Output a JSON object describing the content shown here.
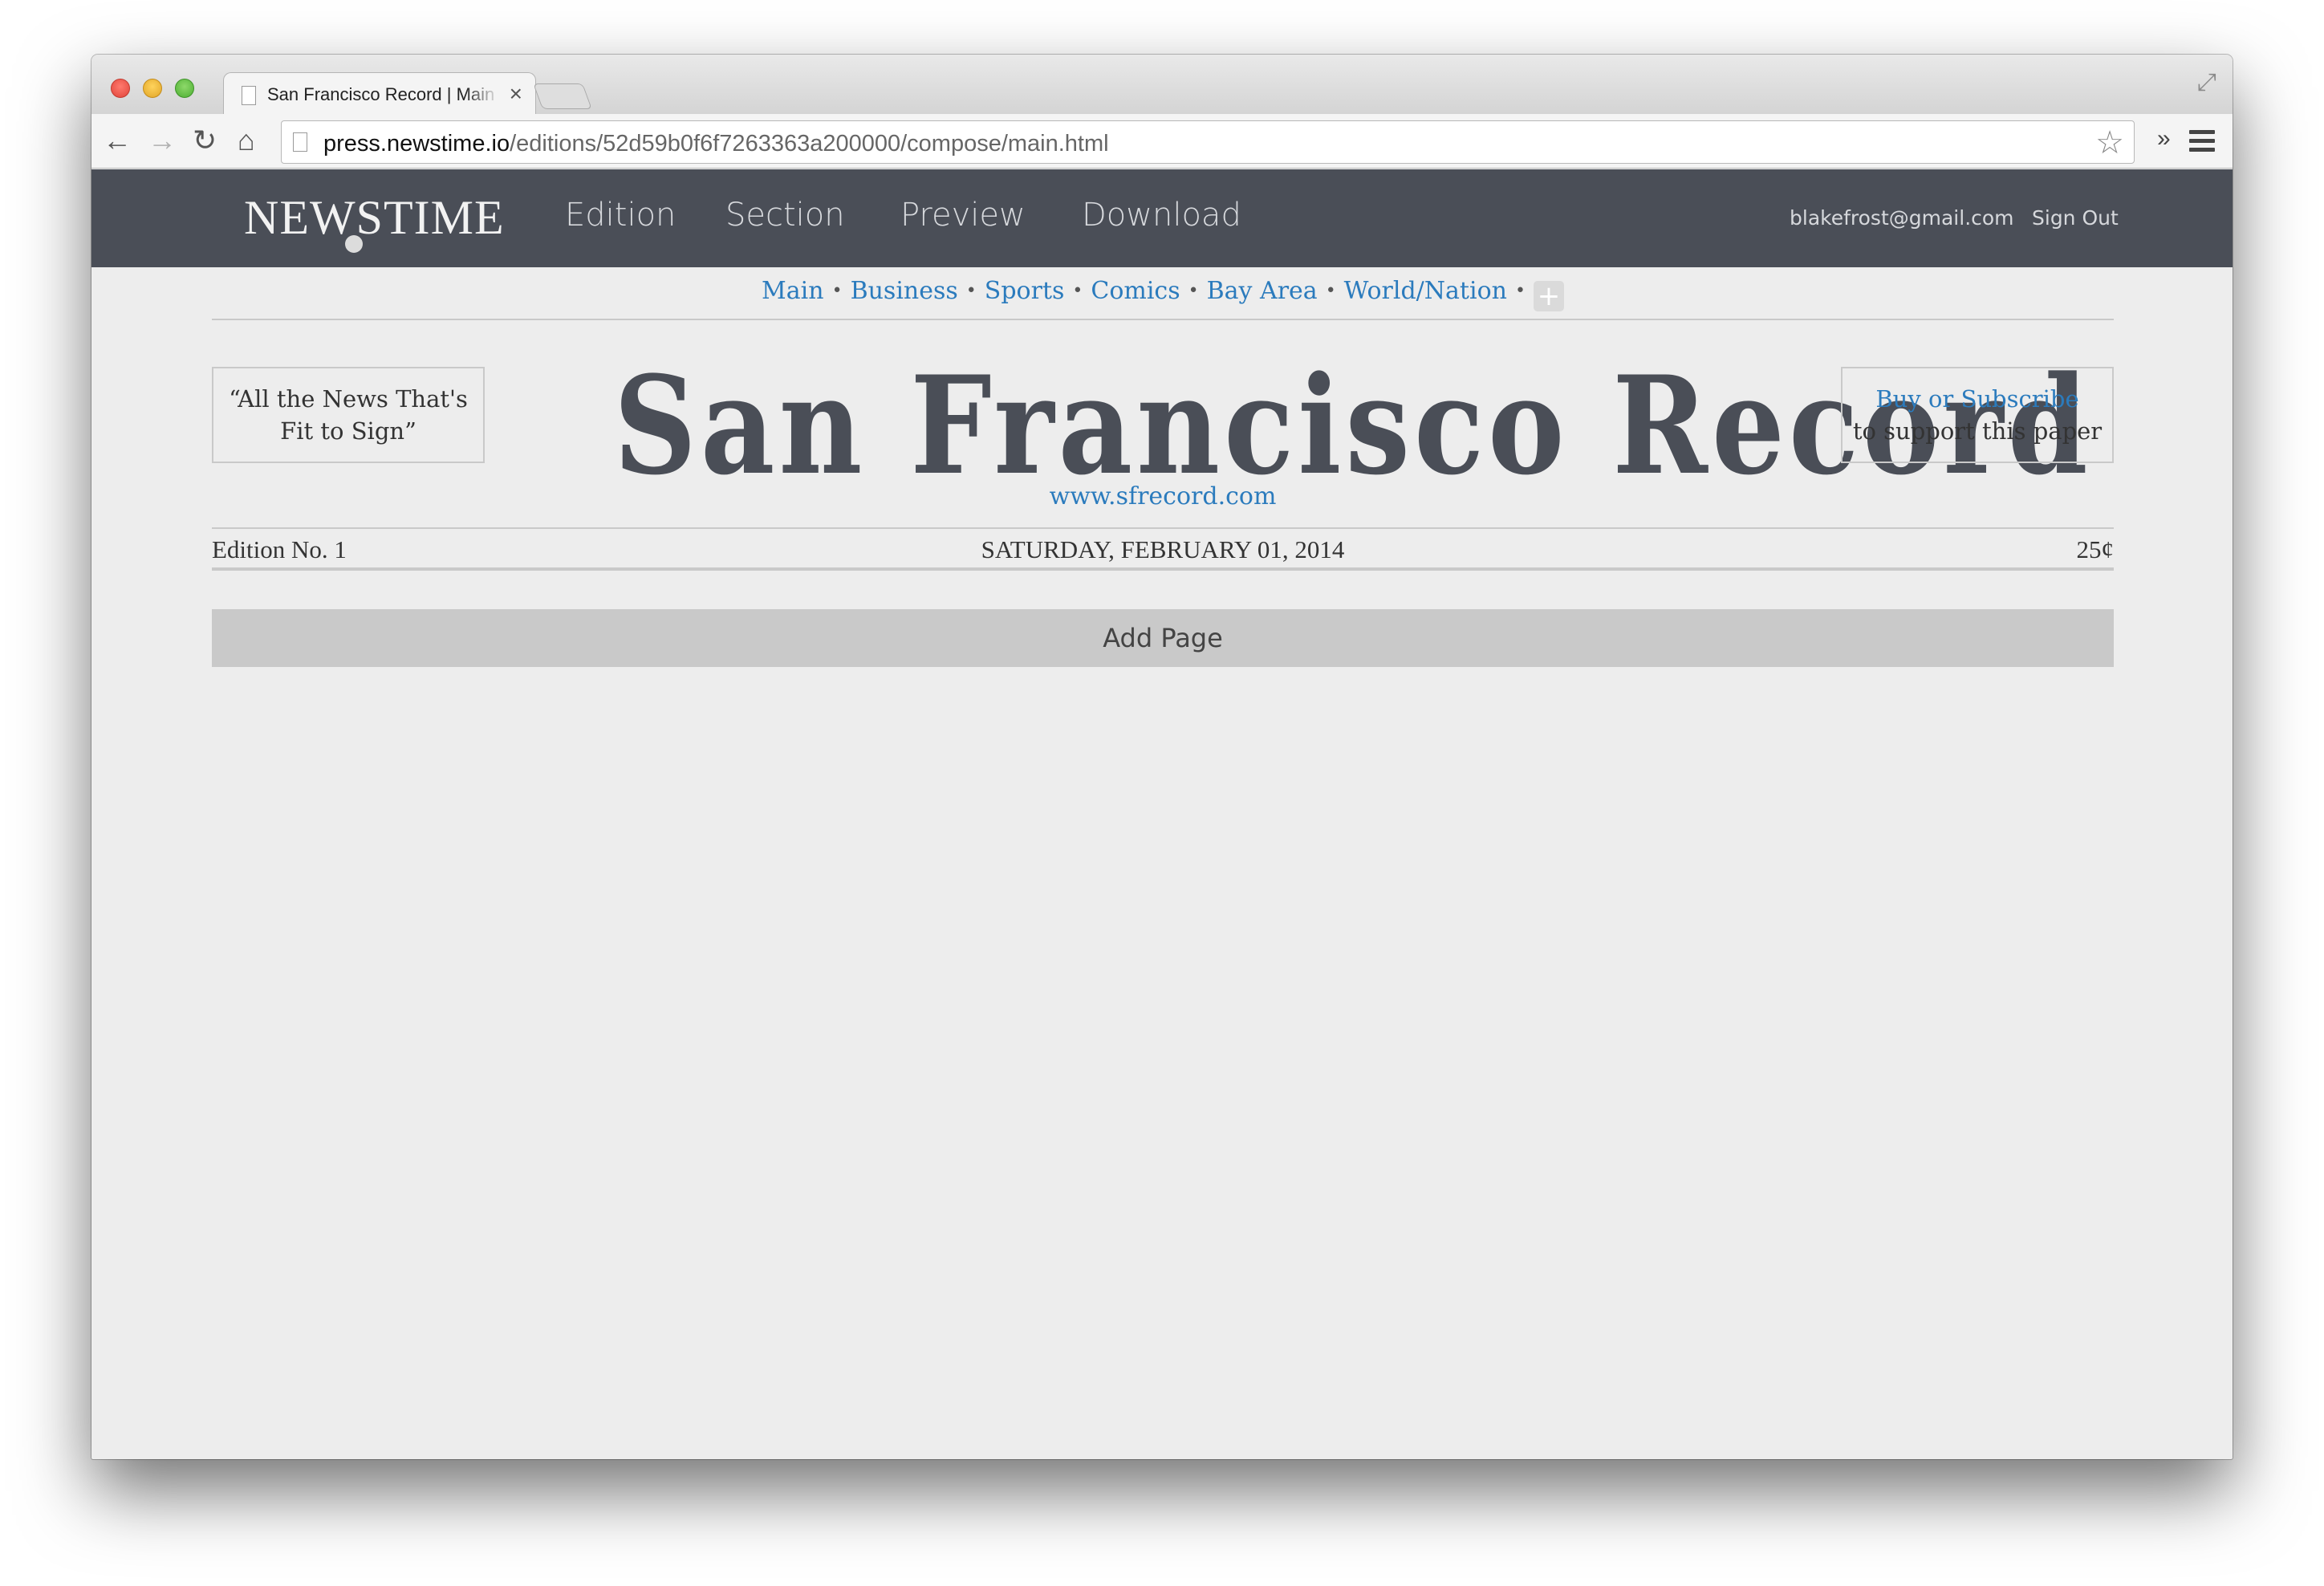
{
  "browser": {
    "tab_title": "San Francisco Record | Main",
    "url_host": "press.newstime.io",
    "url_path": "/editions/52d59b0f6f7263363a200000/compose/main.html"
  },
  "app": {
    "logo": "NEWSTIME",
    "nav": [
      "Edition",
      "Section",
      "Preview",
      "Download"
    ],
    "user_email": "blakefrost@gmail.com",
    "sign_out": "Sign Out"
  },
  "sections": [
    "Main",
    "Business",
    "Sports",
    "Comics",
    "Bay Area",
    "World/Nation"
  ],
  "masthead": {
    "left_ear": "“All the News That's Fit to Sign”",
    "title": "San Francisco Record",
    "url": "www.sfrecord.com",
    "right_ear_link": "Buy or Subscribe",
    "right_ear_text": "to support this paper"
  },
  "dateline": {
    "edition": "Edition No. 1",
    "date": "SATURDAY, FEBRUARY 01, 2014",
    "price": "25¢"
  },
  "add_page_label": "Add Page",
  "colors": {
    "header_bg": "#4a4e57",
    "link": "#2b7bbd",
    "page_bg": "#ededed"
  }
}
